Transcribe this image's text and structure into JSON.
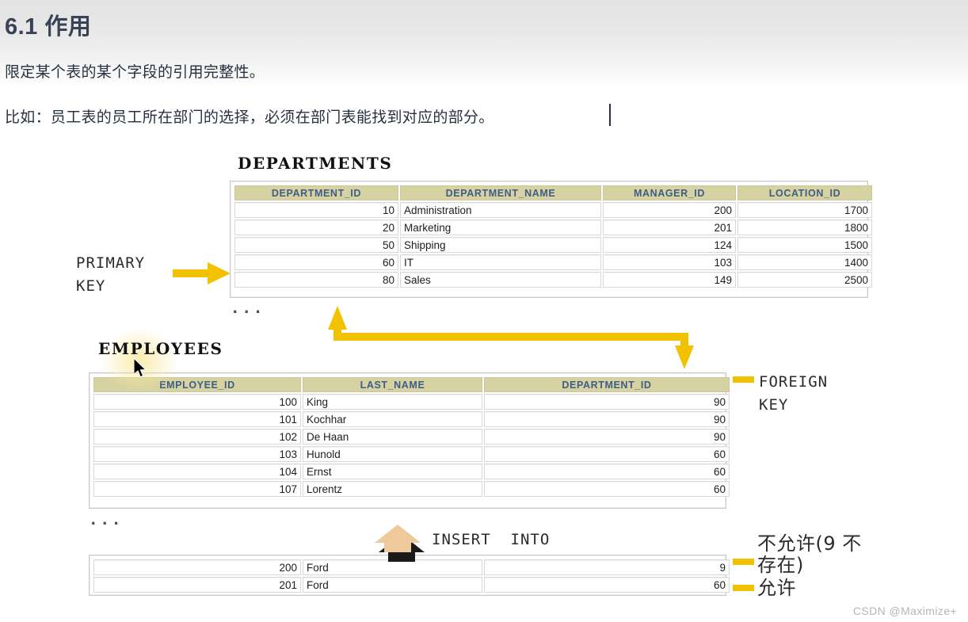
{
  "document": {
    "title": "6.1 作用",
    "paragraph_1": "限定某个表的某个字段的引用完整性。",
    "paragraph_2": "比如：员工表的员工所在部门的选择，必须在部门表能找到对应的部分。"
  },
  "diagram": {
    "departments": {
      "title": "DEPARTMENTS",
      "columns": [
        "DEPARTMENT_ID",
        "DEPARTMENT_NAME",
        "MANAGER_ID",
        "LOCATION_ID"
      ],
      "rows": [
        [
          "10",
          "Administration",
          "200",
          "1700"
        ],
        [
          "20",
          "Marketing",
          "201",
          "1800"
        ],
        [
          "50",
          "Shipping",
          "124",
          "1500"
        ],
        [
          "60",
          "IT",
          "103",
          "1400"
        ],
        [
          "80",
          "Sales",
          "149",
          "2500"
        ]
      ],
      "ellipsis": "..."
    },
    "employees": {
      "title": "EMPLOYEES",
      "columns": [
        "EMPLOYEE_ID",
        "LAST_NAME",
        "DEPARTMENT_ID"
      ],
      "rows": [
        [
          "100",
          "King",
          "90"
        ],
        [
          "101",
          "Kochhar",
          "90"
        ],
        [
          "102",
          "De Haan",
          "90"
        ],
        [
          "103",
          "Hunold",
          "60"
        ],
        [
          "104",
          "Ernst",
          "60"
        ],
        [
          "107",
          "Lorentz",
          "60"
        ]
      ],
      "ellipsis": "...",
      "inserted_rows": [
        [
          "200",
          "Ford",
          "9"
        ],
        [
          "201",
          "Ford",
          "60"
        ]
      ]
    },
    "labels": {
      "primary_key": "PRIMARY\nKEY",
      "foreign_key": "FOREIGN\nKEY",
      "insert_into": "INSERT  INTO",
      "disallowed": "不允许(9 不存在)",
      "allowed": "允许"
    },
    "colors": {
      "arrow_yellow": "#f2c200",
      "insert_arrow_fill": "#eec99a",
      "table_header_bg": "#d7d2a2",
      "table_header_text": "#3e5d86",
      "title_text": "#3a4355"
    }
  },
  "watermark": {
    "text": "CSDN @Maximize+"
  }
}
